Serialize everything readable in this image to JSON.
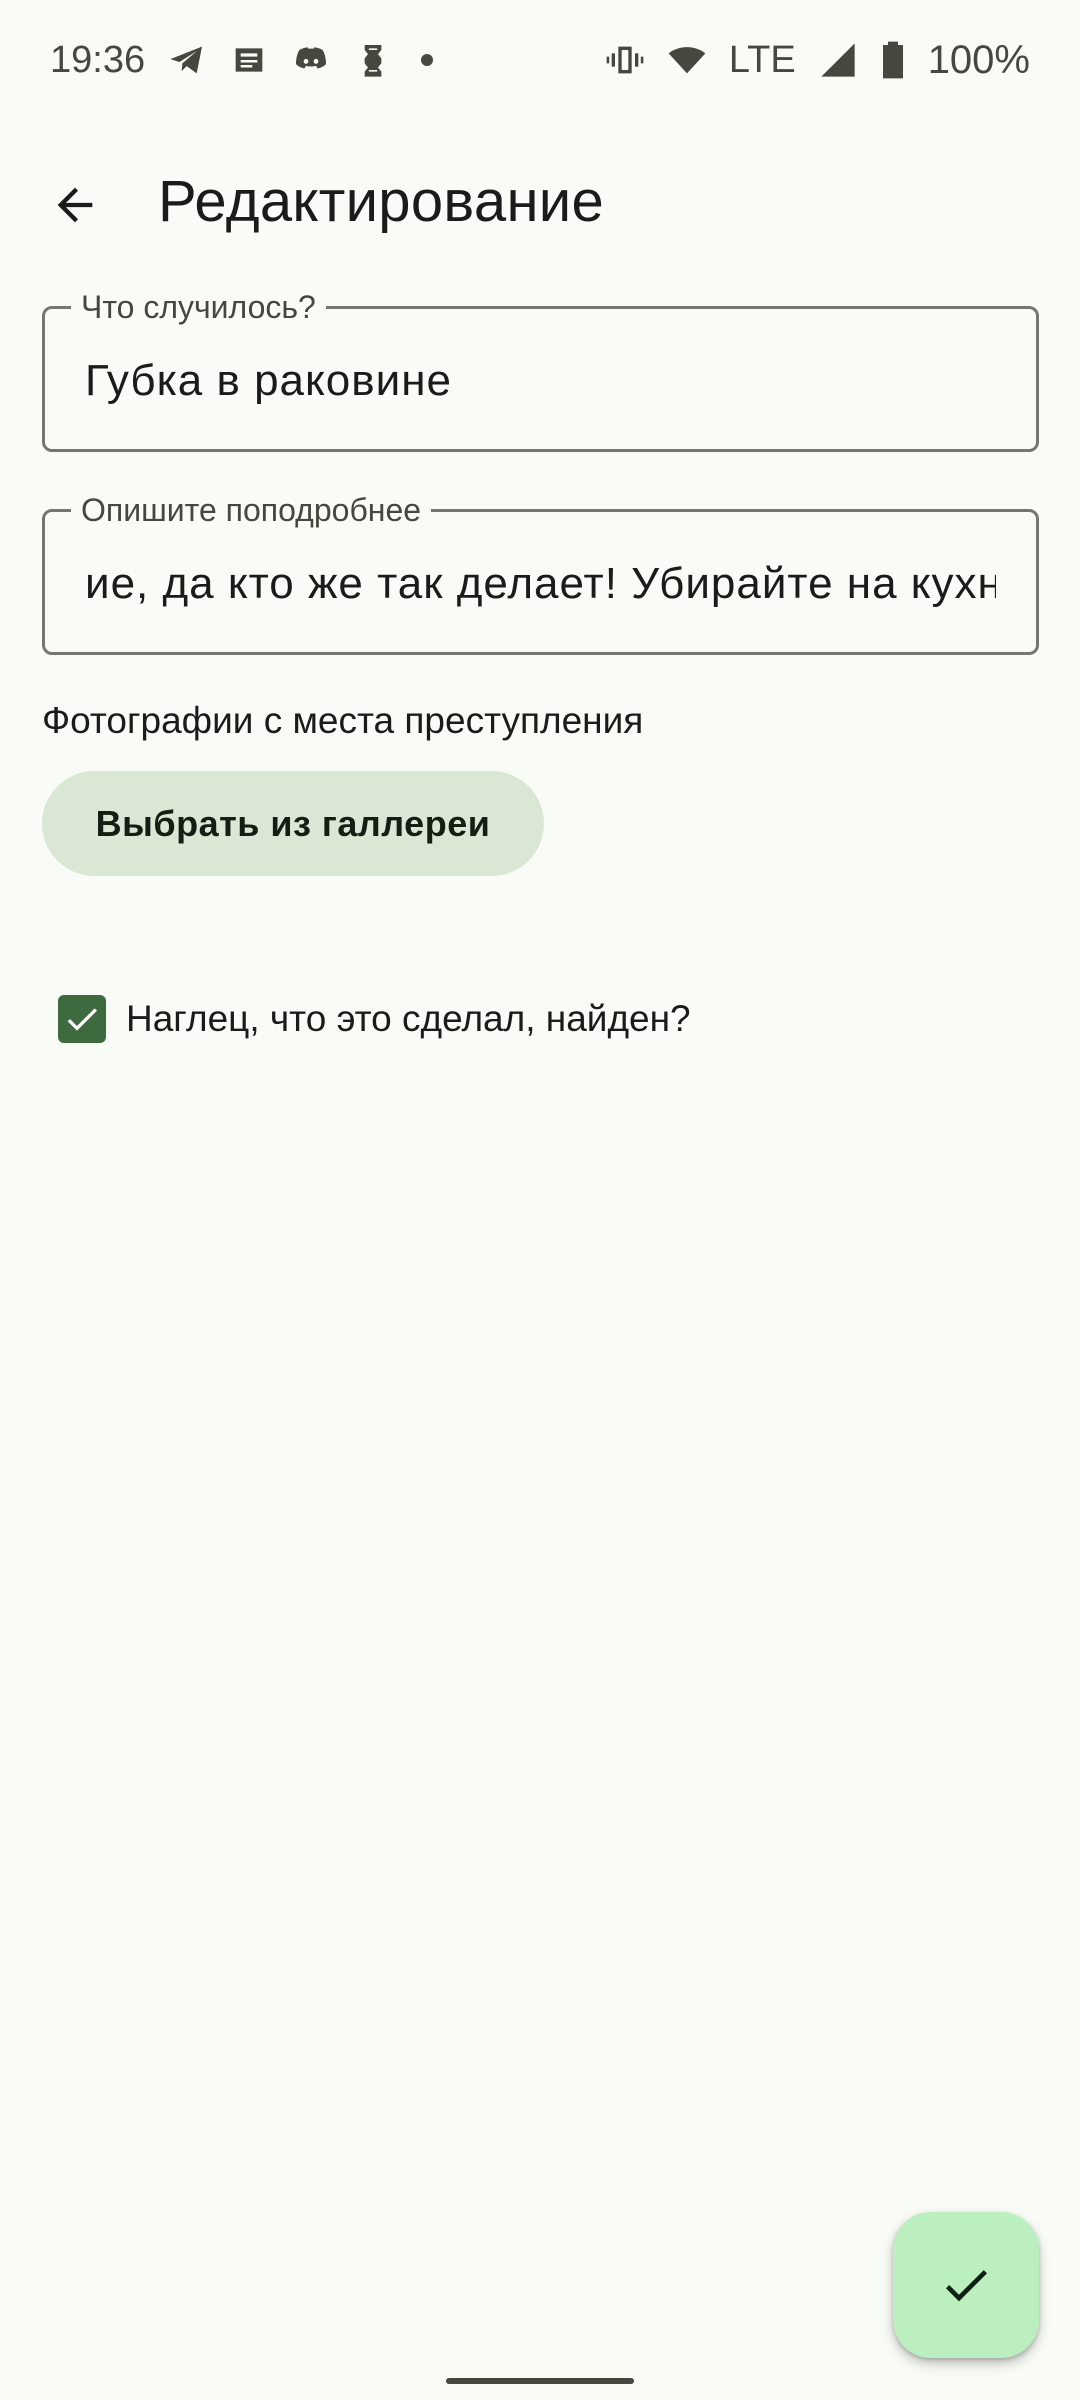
{
  "status_bar": {
    "time": "19:36",
    "notification_icons": [
      "telegram-icon",
      "news-icon",
      "discord-icon",
      "app-icon"
    ],
    "network": "LTE",
    "battery": "100%"
  },
  "app_bar": {
    "title": "Редактирование"
  },
  "form": {
    "what_happened": {
      "label": "Что случилось?",
      "value": "Губка в раковине"
    },
    "description": {
      "label": "Опишите поподробнее",
      "value": "ие, да кто же так делает! Убирайте на кухню"
    },
    "photos_label": "Фотографии с места преступления",
    "gallery_button": "Выбрать из галлереи",
    "culprit_checkbox": {
      "label": "Наглец, что это сделал, найден?",
      "checked": true
    }
  },
  "colors": {
    "background": "#f9fbf6",
    "accent": "#3d6a3f",
    "tonal_button": "#d9e7d4",
    "fab": "#bcefc0"
  }
}
